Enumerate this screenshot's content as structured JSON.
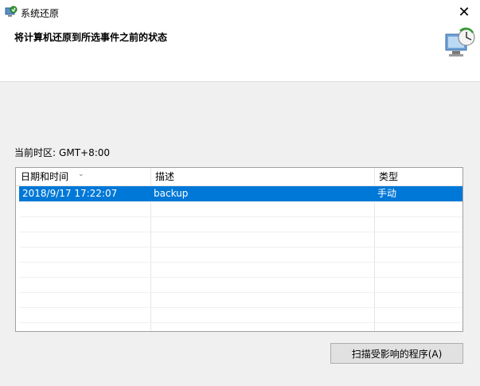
{
  "window": {
    "title": "系统还原",
    "close_glyph": "✕"
  },
  "header": {
    "heading": "将计算机还原到所选事件之前的状态"
  },
  "timezone": {
    "label": "当前时区:",
    "value": "GMT+8:00"
  },
  "table": {
    "columns": [
      "日期和时间",
      "描述",
      "类型"
    ],
    "sort_indicator": "⌄",
    "rows": [
      {
        "date": "2018/9/17 17:22:07",
        "description": "backup",
        "type": "手动",
        "selected": true
      }
    ]
  },
  "actions": {
    "scan_button": "扫描受影响的程序(A)"
  },
  "icons": {
    "app": "system-restore-icon",
    "header": "system-restore-graphic"
  },
  "colors": {
    "selection": "#0078d7"
  }
}
